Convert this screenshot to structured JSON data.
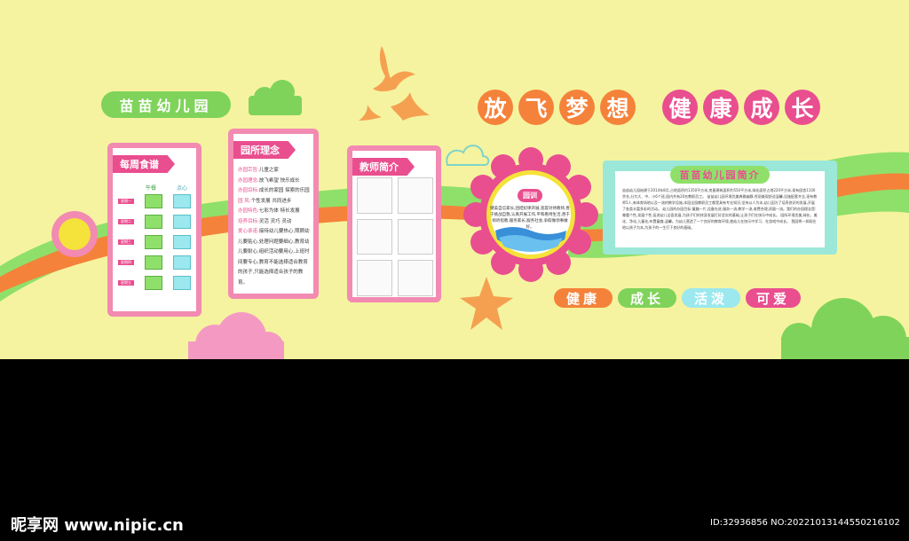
{
  "kindergarten_badge": "苗苗幼儿园",
  "slogan_left": [
    "放",
    "飞",
    "梦",
    "想"
  ],
  "slogan_right": [
    "健",
    "康",
    "成",
    "长"
  ],
  "weekly_menu": {
    "title": "每周食谱",
    "columns": [
      "午餐",
      "点心"
    ],
    "rows": [
      "星期一",
      "星期二",
      "星期三",
      "星期四",
      "星期五"
    ]
  },
  "philosophy": {
    "title": "园所理念",
    "lines": [
      {
        "k": "办园宗旨:",
        "v": "儿童之家"
      },
      {
        "k": "办园理念:",
        "v": "放飞希望  快乐成长"
      },
      {
        "k": "办园目标:",
        "v": "成长的家园  探索的乐园"
      },
      {
        "k": "园    风:",
        "v": "个性发展  共同进步"
      },
      {
        "k": "办园特色:",
        "v": "七彩为体  特长发展"
      },
      {
        "k": "培养目标:",
        "v": "灵活  灵巧  灵动"
      },
      {
        "k": "爱心承诺:",
        "v": "接待幼儿要热心,照顾幼儿要贴心,处理问题要细心,教育幼儿要耐心,组织活动要用心,上班时间要专心,教育不能选择适合教育的孩子,只能选择适合孩子的教育。"
      }
    ]
  },
  "teachers": {
    "title": "教师简介"
  },
  "motto": {
    "badge": "园训",
    "body": "健美自信家长,团结纪律开展,宽容对待教师,善于挑战自我,认真开展工作,平和看待生活,善于倾听指教,服务家长,服务社会,争取做领事做好。"
  },
  "intro": {
    "title": "苗苗幼儿园简介",
    "body": "苗苗幼儿园始建于2014年8月,占地面积约1350平方米,房屋建筑面积约550平方米,绿化面积占地220平方米,现有园舍1100余名,分为大、中、小6个班,园内共有20名教职员工。 苗苗幼儿园环境优美典雅幽静,秀丽美观舒适温馨,设施配套齐全,现有教师5人,有体育场地以及一流的教学设施,本园全园教职员工都是具有专业知识,坚持以人为本,幼儿园为了培养良好的发展,开展了各类丰富多彩的活动。 幼儿园的办园目标:童趣一片,设备先进,服务一流,教学一流,收费合理,质量一流。我们的办园理念是:尊重个性,发展个性,促进幼儿全面发展,为孩子们的终身发展打好坚实的基础,让孩子们在快乐中成长。 园所环境优美,绿化、美化、净化,儿童化,布置童趣,温馨。为幼儿营造了一个良好的教育环境,使幼儿在快乐中学习、在游戏中成长。 我园将一如既往地以孩子为本,为孩子的一生打下良好的基础。"
  },
  "tags": [
    "健康",
    "成长",
    "活泼",
    "可爱"
  ],
  "watermark": "昵享网 www.nipic.cn",
  "image_id": "ID:32936856 NO:20221013144550216102",
  "colors": {
    "wall": "#f5f3a0",
    "pink": "#e94e8f",
    "orange": "#f5823a",
    "green": "#7fd35a",
    "cyan": "#9be8ee"
  }
}
